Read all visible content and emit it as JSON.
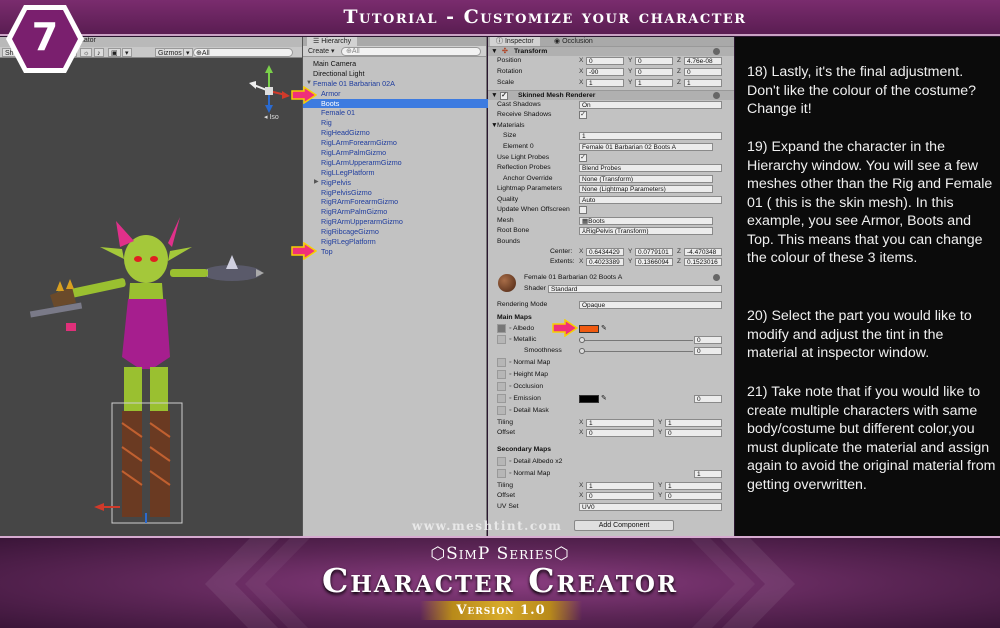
{
  "header": {
    "step_number": "7",
    "title": "Tutorial - Customize your character"
  },
  "scene": {
    "tab_label": "mator",
    "toolbar": [
      "Sh",
      "2D",
      "☼",
      "♪",
      "▣",
      "▾",
      "Gizmos",
      "▾",
      "⊕All"
    ],
    "view_mode": "Iso",
    "watermark": "www.meshtint.com"
  },
  "hierarchy": {
    "tab": "Hierarchy",
    "create_label": "Create",
    "search_placeholder": "⊕All",
    "items": [
      {
        "label": "Main Camera",
        "depth": 0,
        "style": "normal"
      },
      {
        "label": "Directional Light",
        "depth": 0,
        "style": "normal"
      },
      {
        "label": "Female 01 Barbarian 02A",
        "depth": 0,
        "style": "blue",
        "expanded": true
      },
      {
        "label": "Armor",
        "depth": 1,
        "style": "blue"
      },
      {
        "label": "Boots",
        "depth": 1,
        "style": "selected"
      },
      {
        "label": "Female 01",
        "depth": 1,
        "style": "blue"
      },
      {
        "label": "Rig",
        "depth": 1,
        "style": "blue"
      },
      {
        "label": "RigHeadGizmo",
        "depth": 1,
        "style": "blue"
      },
      {
        "label": "RigLArmForearmGizmo",
        "depth": 1,
        "style": "blue"
      },
      {
        "label": "RigLArmPalmGizmo",
        "depth": 1,
        "style": "blue"
      },
      {
        "label": "RigLArmUpperarmGizmo",
        "depth": 1,
        "style": "blue"
      },
      {
        "label": "RigLLegPlatform",
        "depth": 1,
        "style": "blue"
      },
      {
        "label": "RigPelvis",
        "depth": 1,
        "style": "blue",
        "collapsed": true
      },
      {
        "label": "RigPelvisGizmo",
        "depth": 1,
        "style": "blue"
      },
      {
        "label": "RigRArmForearmGizmo",
        "depth": 1,
        "style": "blue"
      },
      {
        "label": "RigRArmPalmGizmo",
        "depth": 1,
        "style": "blue"
      },
      {
        "label": "RigRArmUpperarmGizmo",
        "depth": 1,
        "style": "blue"
      },
      {
        "label": "RigRibcageGizmo",
        "depth": 1,
        "style": "blue"
      },
      {
        "label": "RigRLegPlatform",
        "depth": 1,
        "style": "blue"
      },
      {
        "label": "Top",
        "depth": 1,
        "style": "blue"
      }
    ]
  },
  "inspector": {
    "tabs": [
      "Inspector",
      "Occlusion"
    ],
    "transform": {
      "title": "Transform",
      "position": {
        "label": "Position",
        "x": "0",
        "y": "0",
        "z": "4.76e-08"
      },
      "rotation": {
        "label": "Rotation",
        "x": "-90",
        "y": "0",
        "z": "0"
      },
      "scale": {
        "label": "Scale",
        "x": "1",
        "y": "1",
        "z": "1"
      }
    },
    "smr": {
      "title": "Skinned Mesh Renderer",
      "cast_shadows": {
        "label": "Cast Shadows",
        "value": "On"
      },
      "receive_shadows": {
        "label": "Receive Shadows",
        "checked": "✓"
      },
      "materials": {
        "label": "Materials",
        "size_label": "Size",
        "size": "1",
        "element_label": "Element 0",
        "element": "Female 01 Barbarian 02 Boots A"
      },
      "light_probes": {
        "label": "Use Light Probes",
        "checked": "✓"
      },
      "reflection_probes": {
        "label": "Reflection Probes",
        "value": "Blend Probes"
      },
      "anchor_override": {
        "label": "Anchor Override",
        "value": "None (Transform)"
      },
      "lightmap": {
        "label": "Lightmap Parameters",
        "value": "None (Lightmap Parameters)"
      },
      "quality": {
        "label": "Quality",
        "value": "Auto"
      },
      "update_offscreen": {
        "label": "Update When Offscreen"
      },
      "mesh": {
        "label": "Mesh",
        "value": "Boots"
      },
      "root_bone": {
        "label": "Root Bone",
        "value": "RigPelvis (Transform)"
      },
      "bounds": {
        "label": "Bounds",
        "center_label": "Center:",
        "extents_label": "Extents:",
        "center": {
          "x": "0.6434429",
          "y": "0.0779101",
          "z": "-4.470348"
        },
        "extents": {
          "x": "0.4023389",
          "y": "0.1366094",
          "z": "0.1523016"
        }
      }
    },
    "material": {
      "title": "Female 01 Barbarian 02 Boots A",
      "shader_label": "Shader",
      "shader": "Standard",
      "rendering_mode": {
        "label": "Rendering Mode",
        "value": "Opaque"
      },
      "main_maps": "Main Maps",
      "albedo": {
        "label": "Albedo",
        "color": "#f05a10"
      },
      "metallic": {
        "label": "Metallic",
        "value": "0"
      },
      "smoothness": {
        "label": "Smoothness",
        "value": "0"
      },
      "normal_map": "Normal Map",
      "height_map": "Height Map",
      "occlusion": "Occlusion",
      "emission": {
        "label": "Emission",
        "value": "0",
        "color": "#000000"
      },
      "detail_mask": "Detail Mask",
      "tiling": {
        "label": "Tiling",
        "x": "1",
        "y": "1"
      },
      "offset": {
        "label": "Offset",
        "x": "0",
        "y": "0"
      },
      "secondary_maps": "Secondary Maps",
      "detail_albedo": "Detail Albedo x2",
      "sec_normal_map": {
        "label": "Normal Map",
        "value": "1"
      },
      "sec_tiling": {
        "label": "Tiling",
        "x": "1",
        "y": "1"
      },
      "sec_offset": {
        "label": "Offset",
        "x": "0",
        "y": "0"
      },
      "uv_set": {
        "label": "UV Set",
        "value": "UV0"
      }
    },
    "add_component": "Add Component"
  },
  "instructions": [
    "18) Lastly, it's the final adjustment. Don't like the colour of the costume? Change it!",
    "19) Expand the character in the Hierarchy window. You will see a few meshes other than the Rig and Female 01 ( this is the skin mesh). In this example, you see Armor, Boots and Top. This means that you can change the colour of these 3 items.",
    "20) Select the part you would like to modify and adjust the tint in the material at inspector window.",
    "21) Take note that if you would like to create multiple characters with same body/costume but different color,you must duplicate the material and assign again to avoid the original material from getting overwritten."
  ],
  "footer": {
    "series": "SimP Series",
    "product": "Character Creator",
    "version": "Version 1.0"
  },
  "colors": {
    "banner": "#6a2560",
    "highlight_arrow": "#f0307a",
    "selection": "#3d7be0",
    "albedo": "#f05a10"
  }
}
